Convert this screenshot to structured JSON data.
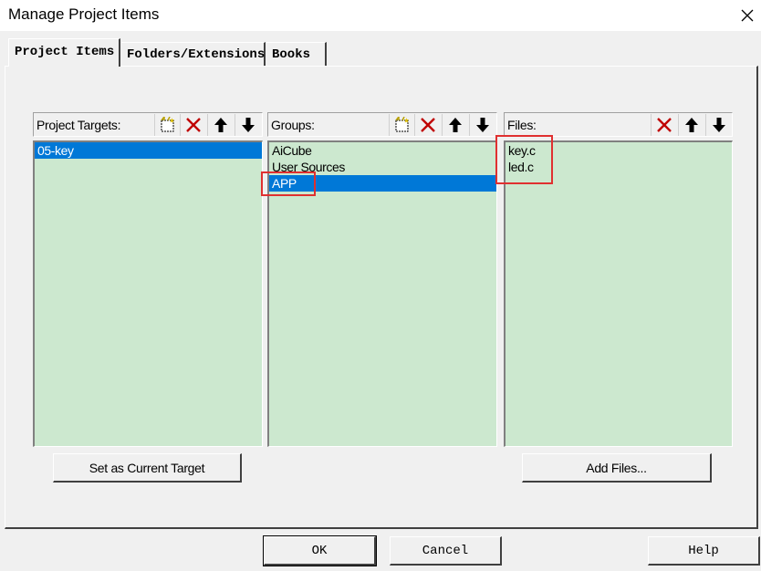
{
  "window": {
    "title": "Manage Project Items"
  },
  "tabs": [
    {
      "label": "Project Items",
      "active": true
    },
    {
      "label": "Folders/Extensions",
      "active": false
    },
    {
      "label": "Books",
      "active": false
    }
  ],
  "panels": {
    "targets": {
      "label": "Project Targets:",
      "items": [
        {
          "label": "05-key",
          "selected": true
        }
      ]
    },
    "groups": {
      "label": "Groups:",
      "items": [
        {
          "label": "AiCube",
          "selected": false
        },
        {
          "label": "User Sources",
          "selected": false
        },
        {
          "label": "APP",
          "selected": true
        }
      ]
    },
    "files": {
      "label": "Files:",
      "items": [
        {
          "label": "key.c",
          "selected": false
        },
        {
          "label": "led.c",
          "selected": false
        }
      ]
    }
  },
  "buttons": {
    "set_target": "Set as Current Target",
    "add_files": "Add Files...",
    "ok": "OK",
    "cancel": "Cancel",
    "help": "Help"
  },
  "icons": {
    "new": "new-item-icon",
    "delete": "delete-icon",
    "up": "move-up-icon",
    "down": "move-down-icon",
    "close": "close-icon"
  },
  "colors": {
    "list_background": "#cce8cf",
    "selection": "#0078d7",
    "annotation": "#e03030",
    "delete_icon": "#c00000"
  }
}
